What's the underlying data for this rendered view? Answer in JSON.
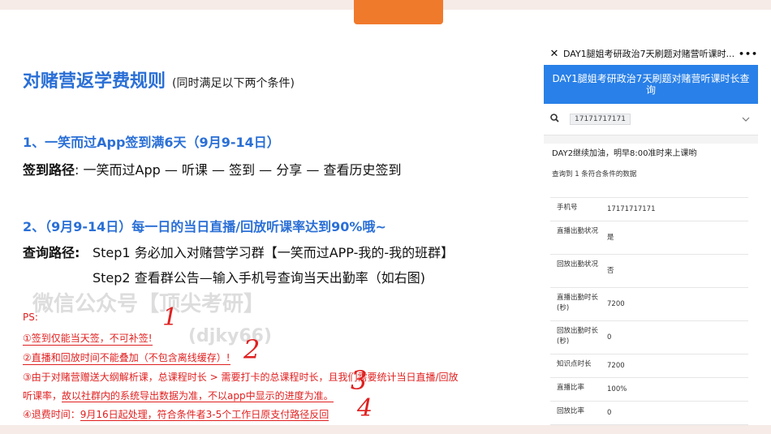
{
  "slide": {
    "title": "对赌营返学费规则",
    "subtitle": "(同时满足以下两个条件)",
    "section1_heading": "1、一笑而过App签到满6天（9月9-14日）",
    "section1_path_label": "签到路径",
    "section1_path": ":  一笑而过App — 听课 — 签到 — 分享 — 查看历史签到",
    "section2_heading": "2、（9月9-14日）每一日的当日直播/回放听课率达到90%哦~",
    "query_label": "查询路径:",
    "step1": "Step1  务必加入对赌营学习群【一笑而过APP-我的-我的班群】",
    "step2": "Step2  查看群公告—输入手机号查询当天出勤率（如右图)",
    "watermark_line1": "微信公众号【顶尖考研】",
    "watermark_line2": "(djky66)",
    "ps": "PS:",
    "note1": "①签到仅能当天签，不可补签!",
    "note2": "②直播和回放时间不能叠加（不包含离线缓存）!",
    "note3_line1": "③由于对赌营赠送大纲解析课，总课程时长 > 需要打卡的总课程时长，且我们需要统计当日直播/回放",
    "note3_line2_prefix": "听课率，",
    "note3_line2_underlined": "故以社群内的系统导出数据为准，不以app中显示的进度为准。",
    "note4_prefix": "④退费时间：",
    "note4_underlined": "9月16日起处理，符合条件者3-5个工作日原支付路径反回",
    "handwritten": [
      "1",
      "2",
      "3",
      "4"
    ]
  },
  "phone": {
    "top_title": "DAY1腿姐考研政治7天刷题对赌营听课时...",
    "more": "•••",
    "close": "✕",
    "banner": "DAY1腿姐考研政治7天刷题对赌营听课时长查询",
    "search_value": "17171717171",
    "notice": "DAY2继续加油，明早8:00准时来上课哟",
    "result_text": "查询到 1 条符合条件的数据",
    "rows": [
      {
        "key": "手机号",
        "value": "17171717171"
      },
      {
        "key": "直播出勤状况",
        "value": "是"
      },
      {
        "key": "回放出勤状况",
        "value": "否"
      },
      {
        "key": "直播出勤时长(秒)",
        "value": "7200"
      },
      {
        "key": "回放出勤时长(秒)",
        "value": "0"
      },
      {
        "key": "知识点时长",
        "value": "7200"
      },
      {
        "key": "直播比率",
        "value": "100%"
      },
      {
        "key": "回放比率",
        "value": "0"
      }
    ]
  },
  "colors": {
    "accent_blue": "#2a6fd6",
    "banner_blue": "#2980e8",
    "note_red": "#e02020",
    "tab_orange": "#f07a2c"
  },
  "icons": [
    "close-icon",
    "more-icon",
    "search-icon",
    "chevron-down-icon"
  ]
}
